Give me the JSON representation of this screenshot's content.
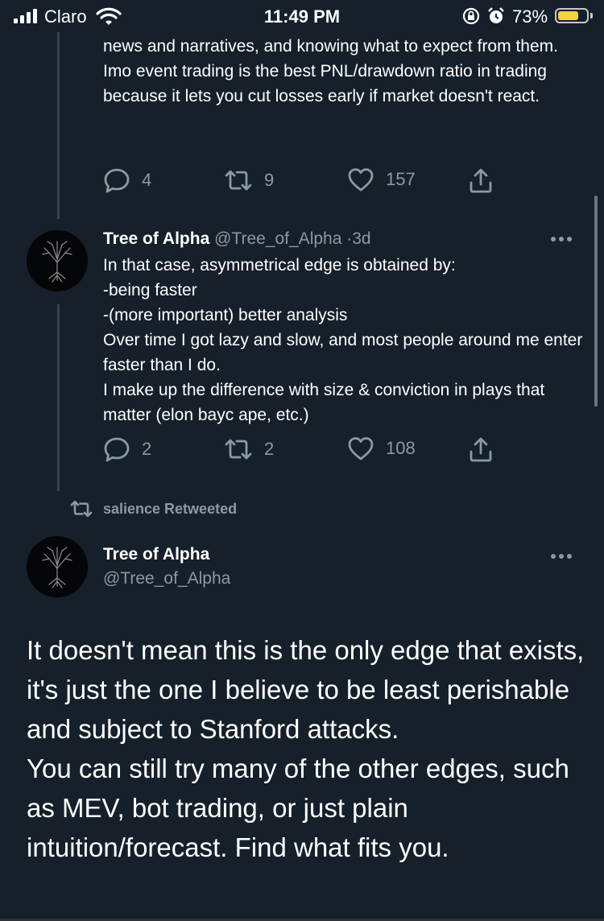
{
  "status_bar": {
    "carrier": "Claro",
    "time": "11:49 PM",
    "battery_percent": "73%",
    "battery_level": 0.73,
    "battery_color": "#f3d33b",
    "icons": [
      "signal-icon",
      "wifi-icon",
      "orientation-lock-icon",
      "alarm-icon",
      "battery-icon"
    ]
  },
  "tweet_partial": {
    "text": "news and narratives, and knowing what to expect from them.\nImo event trading is the best PNL/drawdown ratio in trading because it lets you cut losses early if market doesn't react.",
    "actions": {
      "replies": "4",
      "retweets": "9",
      "likes": "157"
    }
  },
  "tweet_reply": {
    "name": "Tree of Alpha",
    "handle": "@Tree_of_Alpha",
    "separator": "·",
    "time": "3d",
    "text": "In that case, asymmetrical edge is obtained  by:\n-being faster\n-(more important) better analysis\nOver time I got lazy and slow, and most people around me enter faster than I do.\nI make up the difference with size & conviction in plays that matter (elon bayc ape, etc.)",
    "actions": {
      "replies": "2",
      "retweets": "2",
      "likes": "108"
    }
  },
  "retweet_notice": {
    "label": "salience Retweeted"
  },
  "tweet_main": {
    "name": "Tree of Alpha",
    "handle": "@Tree_of_Alpha",
    "text": "It doesn't mean this is the only edge that exists, it's just the one I believe to be least perishable and subject to Stanford attacks.\nYou can still try many of the other edges, such as MEV, bot trading, or just plain intuition/forecast. Find what fits you."
  },
  "colors": {
    "background": "#15202b",
    "muted": "#8b98a5",
    "thread_line": "#38444d"
  }
}
